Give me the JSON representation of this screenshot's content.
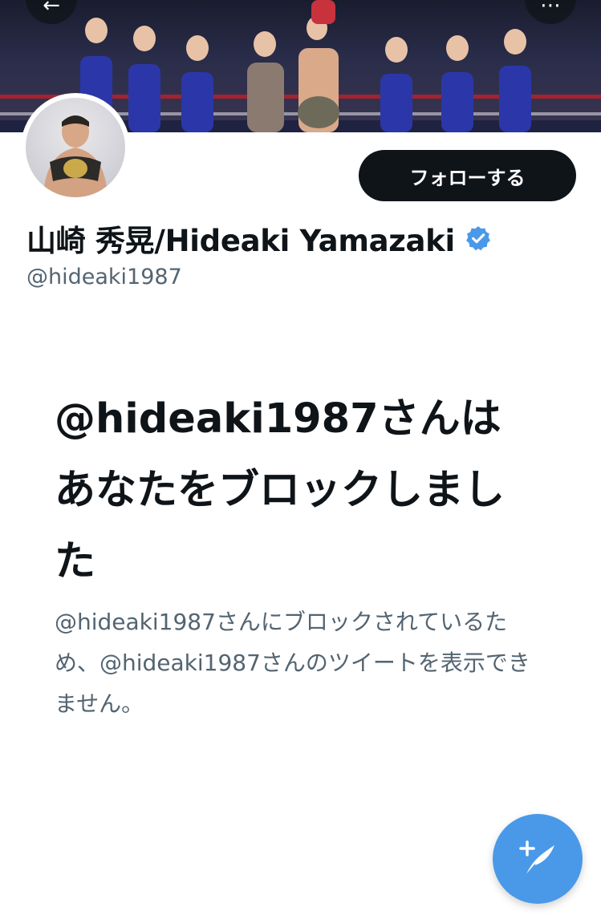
{
  "banner": {
    "back_icon": "arrow-left-icon",
    "more_icon": "ellipsis-icon",
    "back_glyph": "←",
    "more_glyph": "⋯"
  },
  "profile": {
    "display_name": "山崎 秀晃/Hideaki Yamazaki",
    "handle": "@hideaki1987",
    "verified": true,
    "follow_label": "フォローする"
  },
  "blocked": {
    "title": "@hideaki1987さんはあなたをブロックしました",
    "description": "@hideaki1987さんにブロックされているため、@hideaki1987さんのツイートを表示できません。"
  },
  "fab": {
    "icon": "compose-tweet-icon"
  },
  "colors": {
    "accent": "#4a99e9",
    "text_primary": "#0f1419",
    "text_secondary": "#536471",
    "button_dark": "#0f1419"
  }
}
